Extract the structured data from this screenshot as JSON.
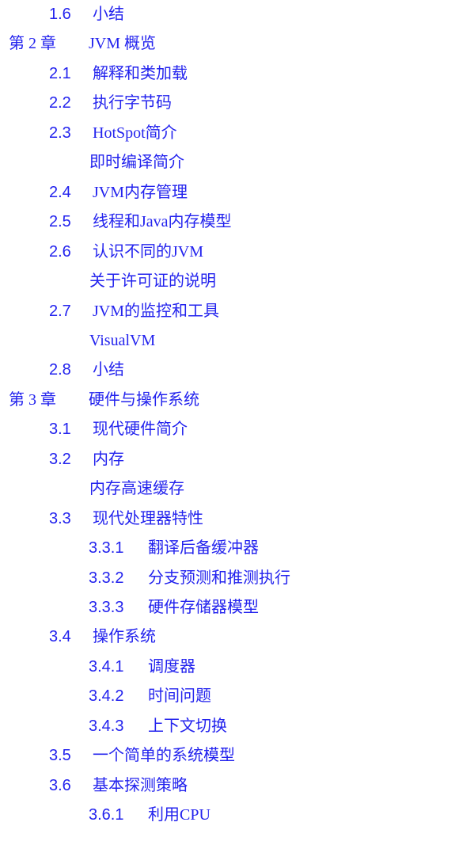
{
  "toc": [
    {
      "level": 1,
      "number": "1.6",
      "title": "小结"
    },
    {
      "level": 0,
      "number": "第 2 章",
      "title": "JVM 概览"
    },
    {
      "level": 1,
      "number": "2.1",
      "title": "解释和类加载"
    },
    {
      "level": 1,
      "number": "2.2",
      "title": "执行字节码"
    },
    {
      "level": 1,
      "number": "2.3",
      "title": "HotSpot简介"
    },
    {
      "level": 3,
      "number": "",
      "title": "即时编译简介"
    },
    {
      "level": 1,
      "number": "2.4",
      "title": "JVM内存管理"
    },
    {
      "level": 1,
      "number": "2.5",
      "title": "线程和Java内存模型"
    },
    {
      "level": 1,
      "number": "2.6",
      "title": "认识不同的JVM"
    },
    {
      "level": 3,
      "number": "",
      "title": "关于许可证的说明"
    },
    {
      "level": 1,
      "number": "2.7",
      "title": "JVM的监控和工具"
    },
    {
      "level": 3,
      "number": "",
      "title": "VisualVM"
    },
    {
      "level": 1,
      "number": "2.8",
      "title": "小结"
    },
    {
      "level": 0,
      "number": "第 3 章",
      "title": "硬件与操作系统"
    },
    {
      "level": 1,
      "number": "3.1",
      "title": "现代硬件简介"
    },
    {
      "level": 1,
      "number": "3.2",
      "title": "内存"
    },
    {
      "level": 3,
      "number": "",
      "title": "内存高速缓存"
    },
    {
      "level": 1,
      "number": "3.3",
      "title": "现代处理器特性"
    },
    {
      "level": 2,
      "number": "3.3.1",
      "title": "翻译后备缓冲器"
    },
    {
      "level": 2,
      "number": "3.3.2",
      "title": "分支预测和推测执行"
    },
    {
      "level": 2,
      "number": "3.3.3",
      "title": "硬件存储器模型"
    },
    {
      "level": 1,
      "number": "3.4",
      "title": "操作系统"
    },
    {
      "level": 2,
      "number": "3.4.1",
      "title": "调度器"
    },
    {
      "level": 2,
      "number": "3.4.2",
      "title": "时间问题"
    },
    {
      "level": 2,
      "number": "3.4.3",
      "title": "上下文切换"
    },
    {
      "level": 1,
      "number": "3.5",
      "title": "一个简单的系统模型"
    },
    {
      "level": 1,
      "number": "3.6",
      "title": "基本探测策略"
    },
    {
      "level": 2,
      "number": "3.6.1",
      "title": "利用CPU"
    }
  ],
  "colors": {
    "link": "#2323ee",
    "background": "#ffffff"
  }
}
